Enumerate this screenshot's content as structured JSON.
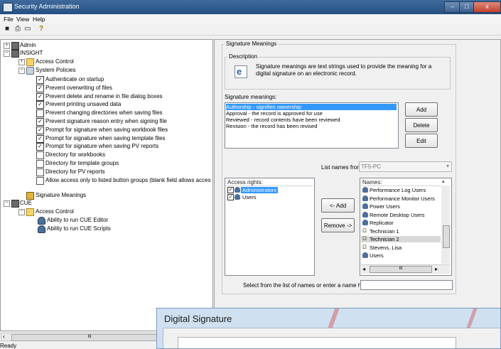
{
  "window": {
    "title": "Security Administration"
  },
  "menu": [
    "File",
    "View",
    "Help"
  ],
  "toolbar": {
    "icons": [
      "save-icon",
      "print-icon",
      "print-preview-icon",
      "help-icon"
    ],
    "glyphs": [
      "■",
      "⎙",
      "▭",
      "?"
    ]
  },
  "tree": {
    "admin": "Admin",
    "insight": "INSIGHT",
    "access_control": "Access Control",
    "system_policies": "System Policies",
    "policies": [
      {
        "label": "Authenticate on startup",
        "checked": true
      },
      {
        "label": "Prevent overwriting of files",
        "checked": true
      },
      {
        "label": "Prevent delete and rename in file dialog boxes",
        "checked": true
      },
      {
        "label": "Prevent printing unsaved data",
        "checked": true
      },
      {
        "label": "Prevent changing directories when saving files",
        "checked": false
      },
      {
        "label": "Prevent signature reason entry when signing file",
        "checked": true
      },
      {
        "label": "Prompt for signature when saving workbook files",
        "checked": true
      },
      {
        "label": "Prompt for signature when saving template files",
        "checked": true
      },
      {
        "label": "Prompt for signature when saving PV reports",
        "checked": true
      }
    ],
    "directories": [
      "Directory for workbooks",
      "Directory for template groups",
      "Directory for PV reports",
      "Allow access only to listed button groups (blank field allows acces"
    ],
    "signature_meanings": "Signature Meanings",
    "cue": "CUE",
    "cue_access_control": "Access Control",
    "cue_items": [
      "Ability to run CUE Editor",
      "Ability to run CUE Scripts"
    ]
  },
  "tree_scroll": {
    "left_arrow": "‹",
    "thumb": "III"
  },
  "status": "Ready",
  "panel": {
    "group_title": "Signature Meanings",
    "description_title": "Description",
    "description_text": "Signature meanings are text strings used to provide the meaning for a digital signature on an electronic record.",
    "meanings_label": "Signature meanings:",
    "meanings": [
      "Authorship - signifies ownership",
      "Approval - the record is approved for use",
      "Reviewed - record contents have been reviewed",
      "Revision - the record has been revised"
    ],
    "selected_meaning": 0,
    "buttons": {
      "add": "Add",
      "delete": "Delete",
      "edit": "Edit",
      "add_right": "<- Add",
      "remove": "Remove ->"
    },
    "list_names_from_label": "List names from:",
    "list_names_from_value": "TF5-PC",
    "access_rights_label": "Access rights:",
    "access_rights": [
      {
        "label": "Administrators",
        "checked": true
      },
      {
        "label": "Users",
        "checked": true
      }
    ],
    "names_label": "Names:",
    "names": [
      {
        "label": "Performance Log Users",
        "kind": "group"
      },
      {
        "label": "Performance Monitor Users",
        "kind": "group"
      },
      {
        "label": "Power Users",
        "kind": "group"
      },
      {
        "label": "Remote Desktop Users",
        "kind": "group"
      },
      {
        "label": "Replicator",
        "kind": "group"
      },
      {
        "label": "Technician 1",
        "kind": "user"
      },
      {
        "label": "Technician 2",
        "kind": "user"
      },
      {
        "label": "Stevens, Lisa",
        "kind": "user"
      },
      {
        "label": "Users",
        "kind": "group"
      }
    ],
    "names_scroll": {
      "left": "◂",
      "thumb": "III",
      "right": "▸"
    },
    "select_label": "Select from the list of names or enter a name here:",
    "select_value": ""
  },
  "dialog": {
    "title": "Digital Signature"
  },
  "colors": {
    "selection": "#3399ff",
    "titlebar": "#2f5a8c"
  }
}
